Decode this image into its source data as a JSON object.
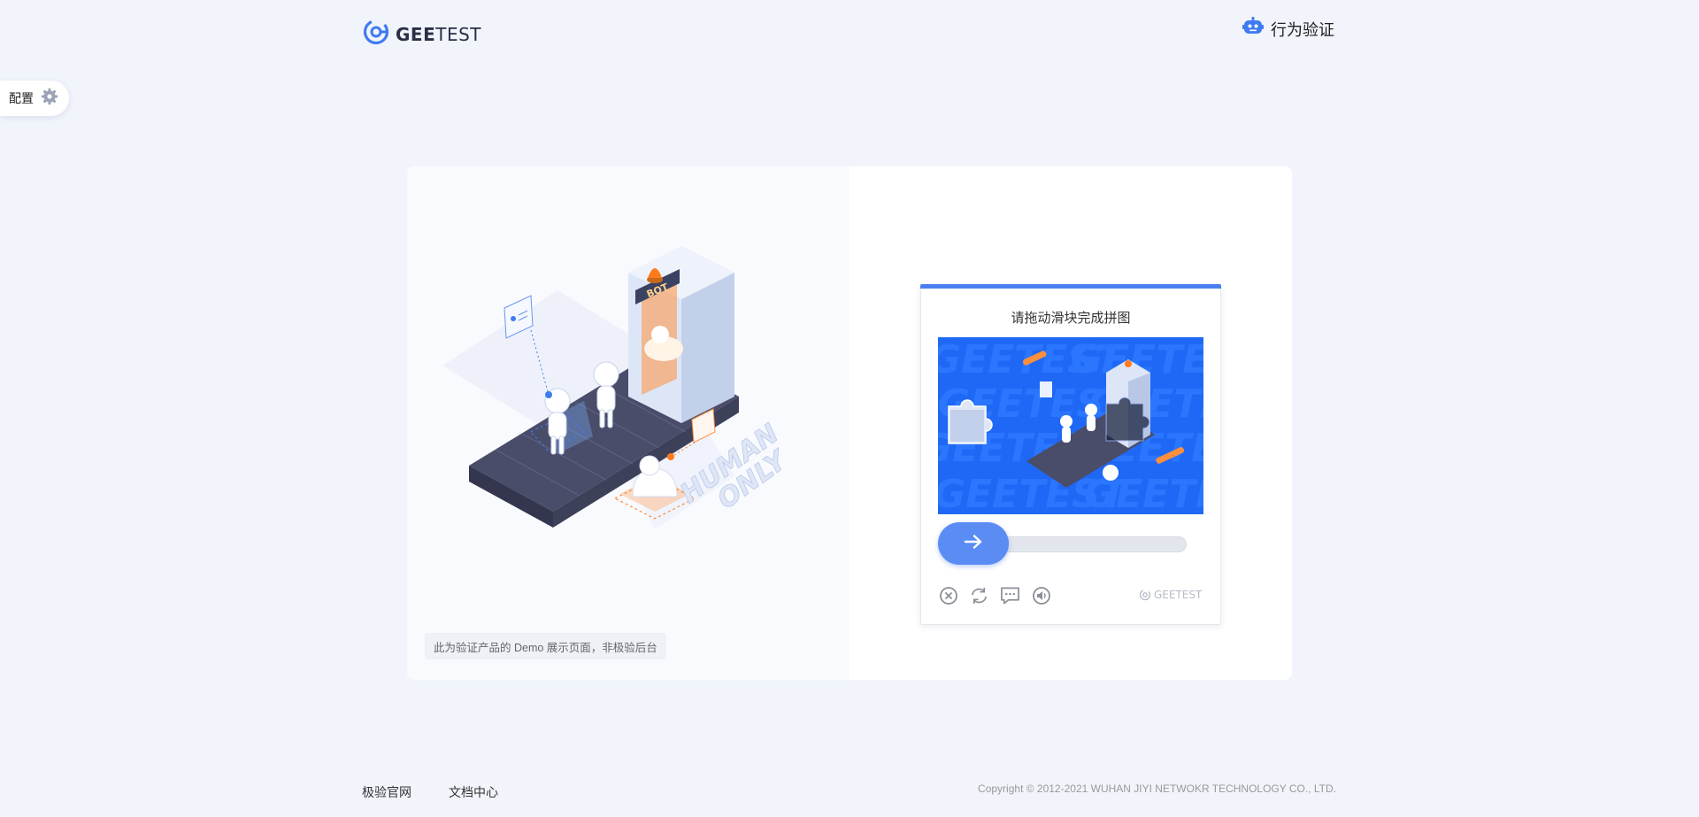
{
  "header": {
    "logo_text_bold": "GEE",
    "logo_text_light": "TEST",
    "right_label": "行为验证"
  },
  "config": {
    "label": "配置"
  },
  "card": {
    "demo_note": "此为验证产品的 Demo 展示页面，非极验后台"
  },
  "illustration": {
    "bot_sign": "BOT",
    "human_only_line1": "HUMAN",
    "human_only_line2": "ONLY"
  },
  "captcha": {
    "title": "请拖动滑块完成拼图",
    "brand": "GEETEST",
    "slider_progress": 0,
    "accent_color": "#4a7ff0",
    "image_bg_color": "#1e68f5",
    "image_watermark_text": "GEETEST",
    "tools": [
      "close-icon",
      "refresh-icon",
      "feedback-icon",
      "audio-icon"
    ]
  },
  "footer": {
    "link_official": "极验官网",
    "link_docs": "文档中心",
    "copyright": "Copyright © 2012-2021 WUHAN JIYI NETWOKR TECHNOLOGY CO., LTD."
  }
}
